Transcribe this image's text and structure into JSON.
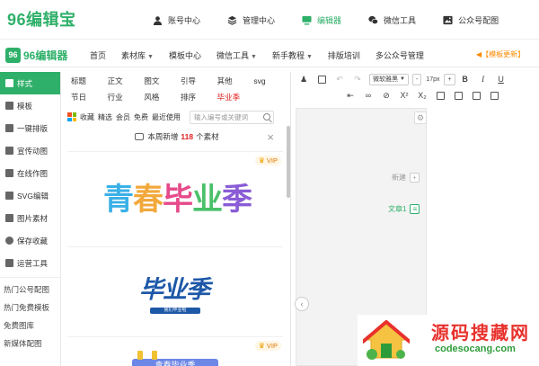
{
  "site": {
    "brand": "96编辑宝",
    "topnav": [
      {
        "label": "账号中心",
        "icon": "user-icon"
      },
      {
        "label": "管理中心",
        "icon": "layers-icon"
      },
      {
        "label": "编辑器",
        "icon": "monitor-icon",
        "active": true
      },
      {
        "label": "微信工具",
        "icon": "wechat-icon"
      },
      {
        "label": "公众号配图",
        "icon": "image-icon"
      }
    ]
  },
  "app": {
    "logo_mark": "96",
    "logo_text": "96编辑器",
    "nav": [
      {
        "label": "首页",
        "dropdown": false
      },
      {
        "label": "素材库",
        "dropdown": true
      },
      {
        "label": "模板中心",
        "dropdown": false
      },
      {
        "label": "微信工具",
        "dropdown": true
      },
      {
        "label": "新手教程",
        "dropdown": true
      },
      {
        "label": "排版培训",
        "dropdown": false
      },
      {
        "label": "多公众号管理",
        "dropdown": false
      }
    ],
    "notice": "◀【模板更新】"
  },
  "sidebar": {
    "items": [
      {
        "label": "样式",
        "active": true
      },
      {
        "label": "模板"
      },
      {
        "label": "一键排版"
      },
      {
        "label": "宣传动图"
      },
      {
        "label": "在线作图"
      },
      {
        "label": "SVG编辑"
      },
      {
        "label": "图片素材"
      },
      {
        "label": "保存收藏"
      },
      {
        "label": "运营工具"
      }
    ],
    "links": [
      "热门公号配图",
      "热门免费模板",
      "免费图库",
      "新媒体配图"
    ]
  },
  "panel": {
    "categories": [
      "标题",
      "正文",
      "图文",
      "引导",
      "其他",
      "svg",
      "节日",
      "行业",
      "风格",
      "排序",
      "毕业季"
    ],
    "hot_category": "毕业季",
    "filters": [
      "收藏",
      "精选",
      "会员",
      "免费",
      "最近使用"
    ],
    "search_placeholder": "输入编号或关键词",
    "new_prefix": "本周新增",
    "new_count": "118",
    "new_suffix": "个素材",
    "close": "×",
    "cards": [
      {
        "vip": "VIP",
        "art": "青春毕业季"
      },
      {
        "art": "毕业季",
        "sub": "我们毕业啦"
      },
      {
        "vip": "VIP",
        "art": "青春毕业季"
      }
    ]
  },
  "editor": {
    "font_family": "微软雅黑",
    "font_size": "17px",
    "minus": "-",
    "plus": "+",
    "side_tools": [
      {
        "label": "新建",
        "active": false
      },
      {
        "label": "文章1",
        "active": true
      }
    ]
  },
  "watermark": {
    "title": "源码搜藏网",
    "url": "codesocang.com"
  }
}
